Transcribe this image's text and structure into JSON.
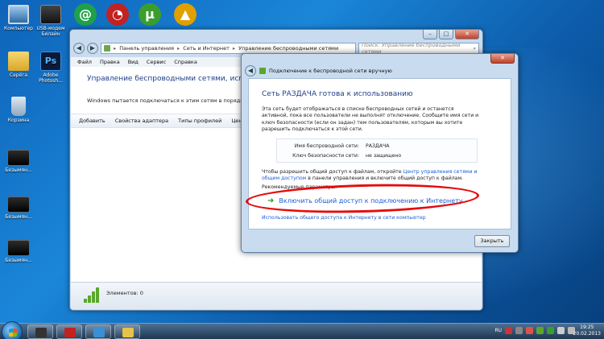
{
  "desktop": {
    "icons": [
      {
        "label": "Компьютер",
        "name": "computer-icon"
      },
      {
        "label": "USB-модем Билайн",
        "name": "usb-modem-icon"
      },
      {
        "label": "Серёга",
        "name": "folder-icon"
      },
      {
        "label": "Adobe Photosh...",
        "name": "photoshop-icon"
      },
      {
        "label": "Корзина",
        "name": "recycle-bin-icon"
      },
      {
        "label": "Безымян...",
        "name": "file-icon"
      },
      {
        "label": "Безымян...",
        "name": "file-icon"
      },
      {
        "label": "Безымян...",
        "name": "file-icon"
      }
    ],
    "top_icons": [
      {
        "name": "mail-agent-icon",
        "glyph": "@",
        "color": "#1ea14a"
      },
      {
        "name": "opera-speed-icon",
        "glyph": "◔",
        "color": "#c12222"
      },
      {
        "name": "utorrent-icon",
        "glyph": "µ",
        "color": "#3a9e2f"
      },
      {
        "name": "aimp-icon",
        "glyph": "▲",
        "color": "#e0a000"
      }
    ]
  },
  "explorer": {
    "address": [
      "Панель управления",
      "Сеть и Интернет",
      "Управление беспроводными сетями"
    ],
    "search_placeholder": "Поиск: Управление беспроводными сетями",
    "menu": [
      "Файл",
      "Правка",
      "Вид",
      "Сервис",
      "Справка"
    ],
    "title": "Управление беспроводными сетями, использую",
    "description": "Windows пытается подключаться к этим сетям в порядке их пре",
    "toolbar": [
      "Добавить",
      "Свойства адаптера",
      "Типы профилей",
      "Центр управ"
    ],
    "status": "Элементов: 0"
  },
  "dialog": {
    "caption": "Подключение к беспроводной сети вручную",
    "close_label": "✕",
    "heading": "Сеть РАЗДАЧА готова к использованию",
    "paragraph": "Эта сеть будет отображаться в списке беспроводных сетей и останется активной, пока все пользователи не выполнят отключение. Сообщите имя сети и ключ безопасности (если он задан) тем пользователям, которым вы хотите разрешить подключаться к этой сети.",
    "network_name_label": "Имя беспроводной сети:",
    "network_name": "РАЗДАЧА",
    "security_key_label": "Ключ безопасности сети:",
    "security_key": "не защищено",
    "share_text_1": "Чтобы разрешить общий доступ к файлам, откройте",
    "share_link": "Центр управления сетями и общим доступом",
    "share_text_2": "в панели управления и включите общий доступ к файлам.",
    "recommended_label": "Рекомендуемые параметры:",
    "enable_sharing": "Включить общий доступ к подключению к Интернету",
    "other_link": "Использовать общего доступа к Интернету в сети компьютер",
    "close_button": "Закрыть"
  },
  "taskbar": {
    "items": [
      {
        "name": "taskbar-usb-modem",
        "color": "#333"
      },
      {
        "name": "taskbar-opera",
        "color": "#c12222"
      },
      {
        "name": "taskbar-control-panel",
        "color": "#3b8fd6"
      },
      {
        "name": "taskbar-explorer",
        "color": "#e7c24a"
      }
    ],
    "language": "RU",
    "time": "19:25",
    "date": "20.02.2013"
  }
}
